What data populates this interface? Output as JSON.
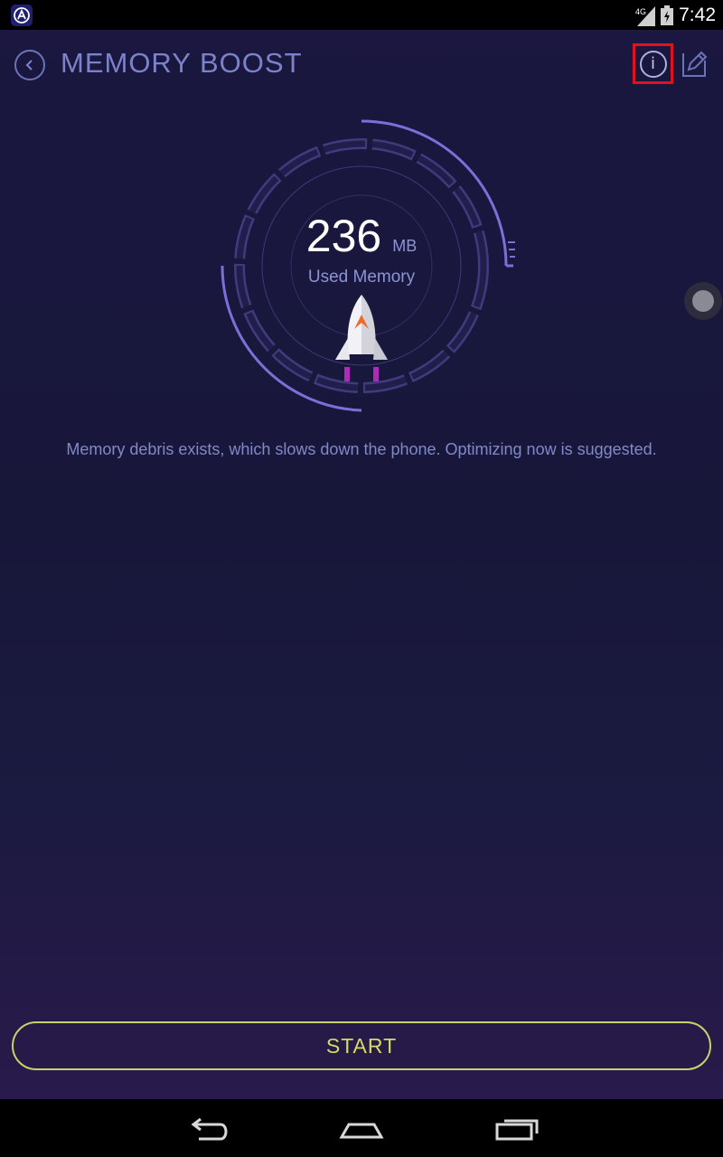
{
  "status_bar": {
    "time": "7:42",
    "network": "4G",
    "icons": [
      "app-notification-icon",
      "signal-4g-icon",
      "battery-charging-icon"
    ]
  },
  "header": {
    "title": "MEMORY BOOST",
    "icons": [
      "back-arrow-icon",
      "info-icon",
      "edit-pencil-icon"
    ]
  },
  "memory": {
    "value": "236",
    "unit": "MB",
    "label": "Used Memory"
  },
  "message": "Memory debris exists, which slows down the phone. Optimizing now is suggested.",
  "actions": {
    "start_label": "START"
  },
  "colors": {
    "accent": "#7b82c9",
    "start_button": "#d4dc62",
    "highlight_box": "#e0121e",
    "background_top": "#1b1740",
    "background_bottom": "#2a1a4c"
  },
  "nav_bar": {
    "icons": [
      "back-icon",
      "home-icon",
      "recents-icon"
    ]
  }
}
